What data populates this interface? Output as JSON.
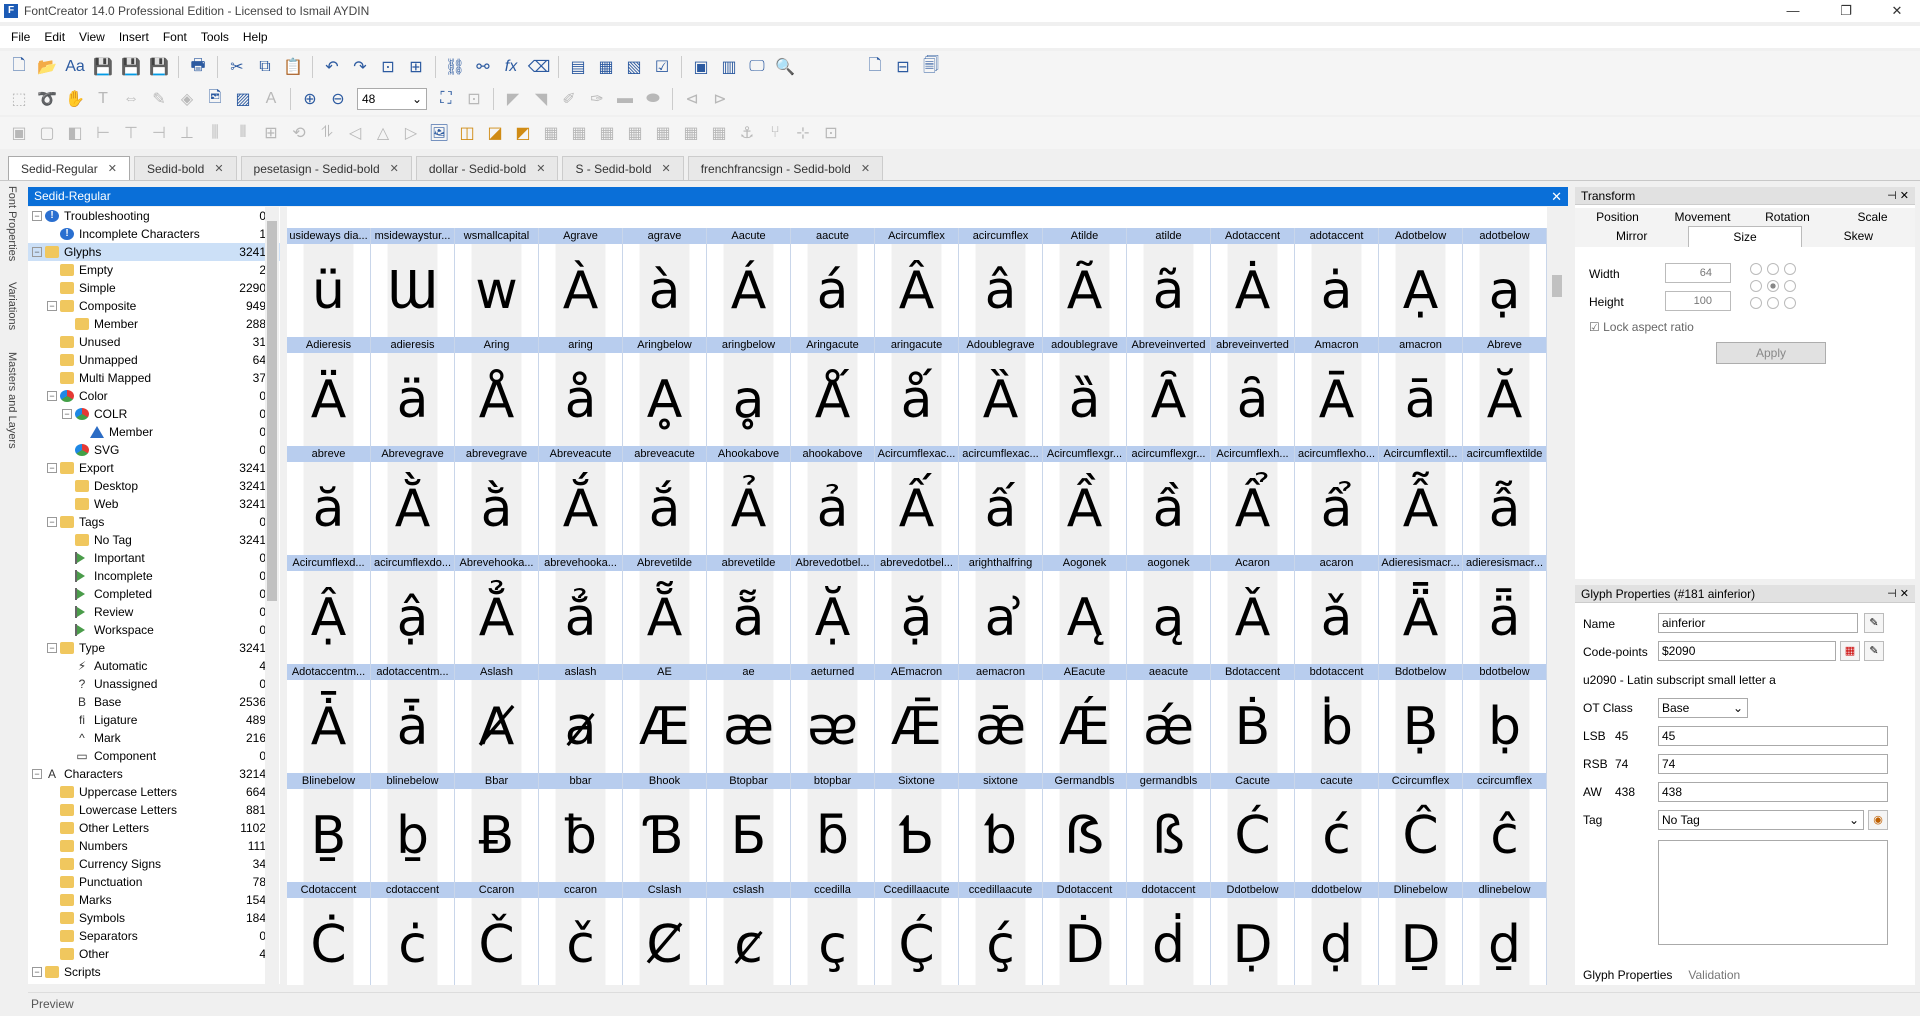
{
  "window": {
    "title": "FontCreator 14.0 Professional Edition - Licensed to Ismail AYDIN",
    "app_icon": "F"
  },
  "menu": [
    "File",
    "Edit",
    "View",
    "Insert",
    "Font",
    "Tools",
    "Help"
  ],
  "zoom": {
    "value": "48"
  },
  "tabs": [
    {
      "label": "Sedid-Regular",
      "active": true
    },
    {
      "label": "Sedid-bold",
      "active": false
    },
    {
      "label": "pesetasign - Sedid-bold",
      "active": false
    },
    {
      "label": "dollar - Sedid-bold",
      "active": false
    },
    {
      "label": "S - Sedid-bold",
      "active": false
    },
    {
      "label": "frenchfrancsign - Sedid-bold",
      "active": false
    }
  ],
  "side_labels": [
    "Font Properties",
    "Variations",
    "Masters and Layers"
  ],
  "document": {
    "title": "Sedid-Regular"
  },
  "tree": [
    {
      "label": "Troubleshooting",
      "count": "0",
      "level": 0,
      "icon": "warn",
      "exp": "-"
    },
    {
      "label": "Incomplete Characters",
      "count": "1",
      "level": 1,
      "icon": "warn",
      "exp": ""
    },
    {
      "label": "Glyphs",
      "count": "3241",
      "level": 0,
      "icon": "folder",
      "exp": "-",
      "selected": true
    },
    {
      "label": "Empty",
      "count": "2",
      "level": 1,
      "icon": "folder",
      "exp": ""
    },
    {
      "label": "Simple",
      "count": "2290",
      "level": 1,
      "icon": "folder",
      "exp": ""
    },
    {
      "label": "Composite",
      "count": "949",
      "level": 1,
      "icon": "folder",
      "exp": "-"
    },
    {
      "label": "Member",
      "count": "288",
      "level": 2,
      "icon": "folder",
      "exp": ""
    },
    {
      "label": "Unused",
      "count": "31",
      "level": 1,
      "icon": "folder",
      "exp": ""
    },
    {
      "label": "Unmapped",
      "count": "64",
      "level": 1,
      "icon": "folder",
      "exp": ""
    },
    {
      "label": "Multi Mapped",
      "count": "37",
      "level": 1,
      "icon": "folder",
      "exp": ""
    },
    {
      "label": "Color",
      "count": "0",
      "level": 1,
      "icon": "colr",
      "exp": "-"
    },
    {
      "label": "COLR",
      "count": "0",
      "level": 2,
      "icon": "colr",
      "exp": "-"
    },
    {
      "label": "Member",
      "count": "0",
      "level": 3,
      "icon": "tri",
      "exp": ""
    },
    {
      "label": "SVG",
      "count": "0",
      "level": 2,
      "icon": "colr",
      "exp": ""
    },
    {
      "label": "Export",
      "count": "3241",
      "level": 1,
      "icon": "folder",
      "exp": "-"
    },
    {
      "label": "Desktop",
      "count": "3241",
      "level": 2,
      "icon": "folder",
      "exp": ""
    },
    {
      "label": "Web",
      "count": "3241",
      "level": 2,
      "icon": "folder",
      "exp": ""
    },
    {
      "label": "Tags",
      "count": "0",
      "level": 1,
      "icon": "folder",
      "exp": "-"
    },
    {
      "label": "No Tag",
      "count": "3241",
      "level": 2,
      "icon": "folder",
      "exp": ""
    },
    {
      "label": "Important",
      "count": "0",
      "level": 2,
      "icon": "flag",
      "exp": ""
    },
    {
      "label": "Incomplete",
      "count": "0",
      "level": 2,
      "icon": "flag",
      "exp": ""
    },
    {
      "label": "Completed",
      "count": "0",
      "level": 2,
      "icon": "flag",
      "exp": ""
    },
    {
      "label": "Review",
      "count": "0",
      "level": 2,
      "icon": "flag",
      "exp": ""
    },
    {
      "label": "Workspace",
      "count": "0",
      "level": 2,
      "icon": "flag",
      "exp": ""
    },
    {
      "label": "Type",
      "count": "3241",
      "level": 1,
      "icon": "folder",
      "exp": "-"
    },
    {
      "label": "Automatic",
      "count": "4",
      "level": 2,
      "icon": "glyph",
      "glyph": "⚡",
      "exp": ""
    },
    {
      "label": "Unassigned",
      "count": "0",
      "level": 2,
      "icon": "glyph",
      "glyph": "?",
      "exp": ""
    },
    {
      "label": "Base",
      "count": "2536",
      "level": 2,
      "icon": "glyph",
      "glyph": "B",
      "exp": ""
    },
    {
      "label": "Ligature",
      "count": "489",
      "level": 2,
      "icon": "glyph",
      "glyph": "ﬁ",
      "exp": ""
    },
    {
      "label": "Mark",
      "count": "216",
      "level": 2,
      "icon": "glyph",
      "glyph": "^",
      "exp": ""
    },
    {
      "label": "Component",
      "count": "0",
      "level": 2,
      "icon": "glyph",
      "glyph": "▭",
      "exp": ""
    },
    {
      "label": "Characters",
      "count": "3214",
      "level": 0,
      "icon": "glyph",
      "glyph": "A",
      "exp": "-"
    },
    {
      "label": "Uppercase Letters",
      "count": "664",
      "level": 1,
      "icon": "folder",
      "exp": ""
    },
    {
      "label": "Lowercase Letters",
      "count": "881",
      "level": 1,
      "icon": "folder",
      "exp": ""
    },
    {
      "label": "Other Letters",
      "count": "1102",
      "level": 1,
      "icon": "folder",
      "exp": ""
    },
    {
      "label": "Numbers",
      "count": "111",
      "level": 1,
      "icon": "folder",
      "exp": ""
    },
    {
      "label": "Currency Signs",
      "count": "34",
      "level": 1,
      "icon": "folder",
      "exp": ""
    },
    {
      "label": "Punctuation",
      "count": "78",
      "level": 1,
      "icon": "folder",
      "exp": ""
    },
    {
      "label": "Marks",
      "count": "154",
      "level": 1,
      "icon": "folder",
      "exp": ""
    },
    {
      "label": "Symbols",
      "count": "184",
      "level": 1,
      "icon": "folder",
      "exp": ""
    },
    {
      "label": "Separators",
      "count": "0",
      "level": 1,
      "icon": "folder",
      "exp": ""
    },
    {
      "label": "Other",
      "count": "4",
      "level": 1,
      "icon": "folder",
      "exp": ""
    },
    {
      "label": "Scripts",
      "count": "",
      "level": 0,
      "icon": "folder",
      "exp": "-"
    }
  ],
  "glyphs": [
    [
      [
        "usideways dia...",
        "ü"
      ],
      [
        "msidewaystur...",
        "Ɯ"
      ],
      [
        "wsmallcapital",
        "ᴡ"
      ],
      [
        "Agrave",
        "À"
      ],
      [
        "agrave",
        "à"
      ],
      [
        "Aacute",
        "Á"
      ],
      [
        "aacute",
        "á"
      ],
      [
        "Acircumflex",
        "Â"
      ],
      [
        "acircumflex",
        "â"
      ],
      [
        "Atilde",
        "Ã"
      ],
      [
        "atilde",
        "ã"
      ],
      [
        "Adotaccent",
        "Ȧ"
      ],
      [
        "adotaccent",
        "ȧ"
      ],
      [
        "Adotbelow",
        "Ạ"
      ],
      [
        "adotbelow",
        "ạ"
      ]
    ],
    [
      [
        "Adieresis",
        "Ä"
      ],
      [
        "adieresis",
        "ä"
      ],
      [
        "Aring",
        "Å"
      ],
      [
        "aring",
        "å"
      ],
      [
        "Aringbelow",
        "Ḁ"
      ],
      [
        "aringbelow",
        "ḁ"
      ],
      [
        "Aringacute",
        "Ǻ"
      ],
      [
        "aringacute",
        "ǻ"
      ],
      [
        "Adoublegrave",
        "Ȁ"
      ],
      [
        "adoublegrave",
        "ȁ"
      ],
      [
        "Abreveinverted",
        "Ȃ"
      ],
      [
        "abreveinverted",
        "ȃ"
      ],
      [
        "Amacron",
        "Ā"
      ],
      [
        "amacron",
        "ā"
      ],
      [
        "Abreve",
        "Ă"
      ]
    ],
    [
      [
        "abreve",
        "ă"
      ],
      [
        "Abrevegrave",
        "Ằ"
      ],
      [
        "abrevegrave",
        "ằ"
      ],
      [
        "Abreveacute",
        "Ắ"
      ],
      [
        "abreveacute",
        "ắ"
      ],
      [
        "Ahookabove",
        "Ả"
      ],
      [
        "ahookabove",
        "ả"
      ],
      [
        "Acircumflexac...",
        "Ấ"
      ],
      [
        "acircumflexac...",
        "ấ"
      ],
      [
        "Acircumflexgr...",
        "Ầ"
      ],
      [
        "acircumflexgr...",
        "ầ"
      ],
      [
        "Acircumflexh...",
        "Ẩ"
      ],
      [
        "acircumflexho...",
        "ẩ"
      ],
      [
        "Acircumflextil...",
        "Ẫ"
      ],
      [
        "acircumflextilde",
        "ẫ"
      ]
    ],
    [
      [
        "Acircumflexd...",
        "Ậ"
      ],
      [
        "acircumflexdo...",
        "ậ"
      ],
      [
        "Abrevehooka...",
        "Ẳ"
      ],
      [
        "abrevehooka...",
        "ẳ"
      ],
      [
        "Abrevetilde",
        "Ẵ"
      ],
      [
        "abrevetilde",
        "ẵ"
      ],
      [
        "Abrevedotbel...",
        "Ặ"
      ],
      [
        "abrevedotbel...",
        "ặ"
      ],
      [
        "arighthalfring",
        "ẚ"
      ],
      [
        "Aogonek",
        "Ą"
      ],
      [
        "aogonek",
        "ą"
      ],
      [
        "Acaron",
        "Ǎ"
      ],
      [
        "acaron",
        "ǎ"
      ],
      [
        "Adieresismacr...",
        "Ǟ"
      ],
      [
        "adieresismacr...",
        "ǟ"
      ]
    ],
    [
      [
        "Adotaccentm...",
        "Ǡ"
      ],
      [
        "adotaccentm...",
        "ǡ"
      ],
      [
        "Aslash",
        "Ⱥ"
      ],
      [
        "aslash",
        "ⱥ"
      ],
      [
        "AE",
        "Æ"
      ],
      [
        "ae",
        "æ"
      ],
      [
        "aeturned",
        "ᴂ"
      ],
      [
        "AEmacron",
        "Ǣ"
      ],
      [
        "aemacron",
        "ǣ"
      ],
      [
        "AEacute",
        "Ǽ"
      ],
      [
        "aeacute",
        "ǽ"
      ],
      [
        "Bdotaccent",
        "Ḃ"
      ],
      [
        "bdotaccent",
        "ḃ"
      ],
      [
        "Bdotbelow",
        "Ḅ"
      ],
      [
        "bdotbelow",
        "ḅ"
      ]
    ],
    [
      [
        "Blinebelow",
        "Ḇ"
      ],
      [
        "blinebelow",
        "ḇ"
      ],
      [
        "Bbar",
        "Ƀ"
      ],
      [
        "bbar",
        "ƀ"
      ],
      [
        "Bhook",
        "Ɓ"
      ],
      [
        "Btopbar",
        "Ƃ"
      ],
      [
        "btopbar",
        "ƃ"
      ],
      [
        "Sixtone",
        "Ƅ"
      ],
      [
        "sixtone",
        "ƅ"
      ],
      [
        "Germandbls",
        "ẞ"
      ],
      [
        "germandbls",
        "ß"
      ],
      [
        "Cacute",
        "Ć"
      ],
      [
        "cacute",
        "ć"
      ],
      [
        "Ccircumflex",
        "Ĉ"
      ],
      [
        "ccircumflex",
        "ĉ"
      ]
    ],
    [
      [
        "Cdotaccent",
        "Ċ"
      ],
      [
        "cdotaccent",
        "ċ"
      ],
      [
        "Ccaron",
        "Č"
      ],
      [
        "ccaron",
        "č"
      ],
      [
        "Cslash",
        "Ȼ"
      ],
      [
        "cslash",
        "ȼ"
      ],
      [
        "ccedilla",
        "ç"
      ],
      [
        "Ccedillaacute",
        "Ḉ"
      ],
      [
        "ccedillaacute",
        "ḉ"
      ],
      [
        "Ddotaccent",
        "Ḋ"
      ],
      [
        "ddotaccent",
        "ḋ"
      ],
      [
        "Ddotbelow",
        "Ḍ"
      ],
      [
        "ddotbelow",
        "ḍ"
      ],
      [
        "Dlinebelow",
        "Ḏ"
      ],
      [
        "dlinebelow",
        "ḏ"
      ]
    ]
  ],
  "transform": {
    "title": "Transform",
    "tabs_row1": [
      "Position",
      "Movement",
      "Rotation",
      "Scale"
    ],
    "tabs_row2": [
      "Mirror",
      "Size",
      "Skew"
    ],
    "active_tab": "Size",
    "width_label": "Width",
    "width_value": "64",
    "height_label": "Height",
    "height_value": "100",
    "lock_label": "Lock aspect ratio",
    "apply_label": "Apply"
  },
  "glyph_props": {
    "title": "Glyph Properties (#181 ainferior)",
    "name_label": "Name",
    "name_value": "ainferior",
    "codepoints_label": "Code-points",
    "codepoints_value": "$2090",
    "description": "u2090 - Latin subscript small letter a",
    "otclass_label": "OT Class",
    "otclass_value": "Base",
    "lsb_label": "LSB",
    "lsb_num": "45",
    "lsb_value": "45",
    "rsb_label": "RSB",
    "rsb_num": "74",
    "rsb_value": "74",
    "aw_label": "AW",
    "aw_num": "438",
    "aw_value": "438",
    "tag_label": "Tag",
    "tag_value": "No Tag",
    "bottom_tabs": [
      "Glyph Properties",
      "Validation"
    ]
  },
  "preview_label": "Preview",
  "colors": {
    "accent": "#0a6fd8",
    "glyph_header": "#b8cdee",
    "selected": "#cce0f7"
  }
}
